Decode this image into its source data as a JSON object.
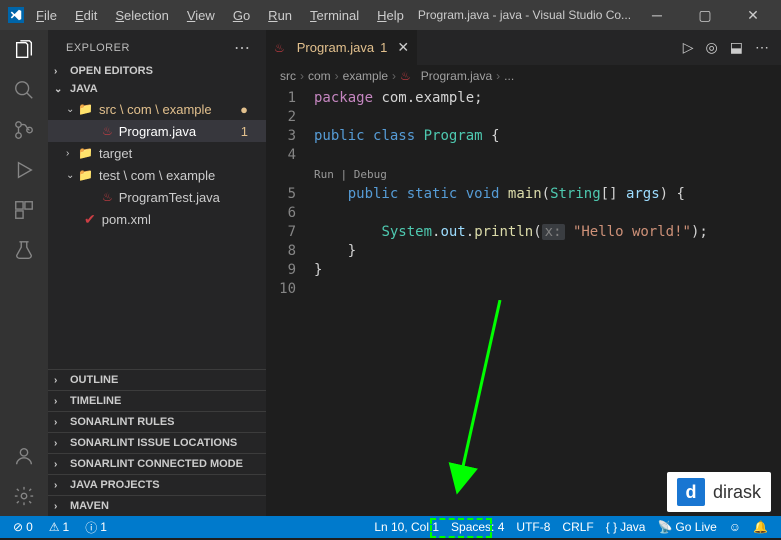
{
  "titlebar": {
    "title": "Program.java - java - Visual Studio Co...",
    "menu": {
      "file": "File",
      "edit": "Edit",
      "selection": "Selection",
      "view": "View",
      "go": "Go",
      "run": "Run",
      "terminal": "Terminal",
      "help": "Help"
    }
  },
  "sidebar": {
    "title": "EXPLORER",
    "open_editors": "OPEN EDITORS",
    "project": "JAVA",
    "tree": {
      "src": "src \\ com \\ example",
      "program": "Program.java",
      "program_count": "1",
      "target": "target",
      "test": "test \\ com \\ example",
      "programtest": "ProgramTest.java",
      "pom": "pom.xml"
    },
    "panels": {
      "outline": "OUTLINE",
      "timeline": "TIMELINE",
      "sl_rules": "SONARLINT RULES",
      "sl_issues": "SONARLINT ISSUE LOCATIONS",
      "sl_connected": "SONARLINT CONNECTED MODE",
      "java_projects": "JAVA PROJECTS",
      "maven": "MAVEN"
    }
  },
  "editor": {
    "tab": {
      "label": "Program.java",
      "badge": "1"
    },
    "breadcrumb": {
      "p1": "src",
      "p2": "com",
      "p3": "example",
      "p4": "Program.java",
      "p5": "..."
    },
    "lines": {
      "l1": "1",
      "l2": "2",
      "l3": "3",
      "l4": "4",
      "l5": "5",
      "l6": "6",
      "l7": "7",
      "l8": "8",
      "l9": "9",
      "l10": "10"
    },
    "codelens": {
      "run": "Run",
      "debug": "Debug"
    },
    "code": {
      "package": "package",
      "com_example": "com.example",
      "semi": ";",
      "public": "public",
      "class": "class",
      "Program": "Program",
      "lbrace": "{",
      "static": "static",
      "void": "void",
      "main": "main",
      "lparen": "(",
      "String": "String",
      "brackets": "[]",
      "args": "args",
      "rparen": ")",
      "System": "System",
      "out": "out",
      "println": "println",
      "x_hint": "x:",
      "hello": "\"Hello world!\"",
      "rbrace": "}"
    }
  },
  "statusbar": {
    "errors": "0",
    "warnings": "1",
    "info": "1",
    "ln_col": "Ln 10, Col 1",
    "spaces": "Spaces: 4",
    "encoding": "UTF-8",
    "eol": "CRLF",
    "lang": "Java",
    "golive": "Go Live"
  },
  "watermark": {
    "logo": "d",
    "text": "dirask"
  }
}
